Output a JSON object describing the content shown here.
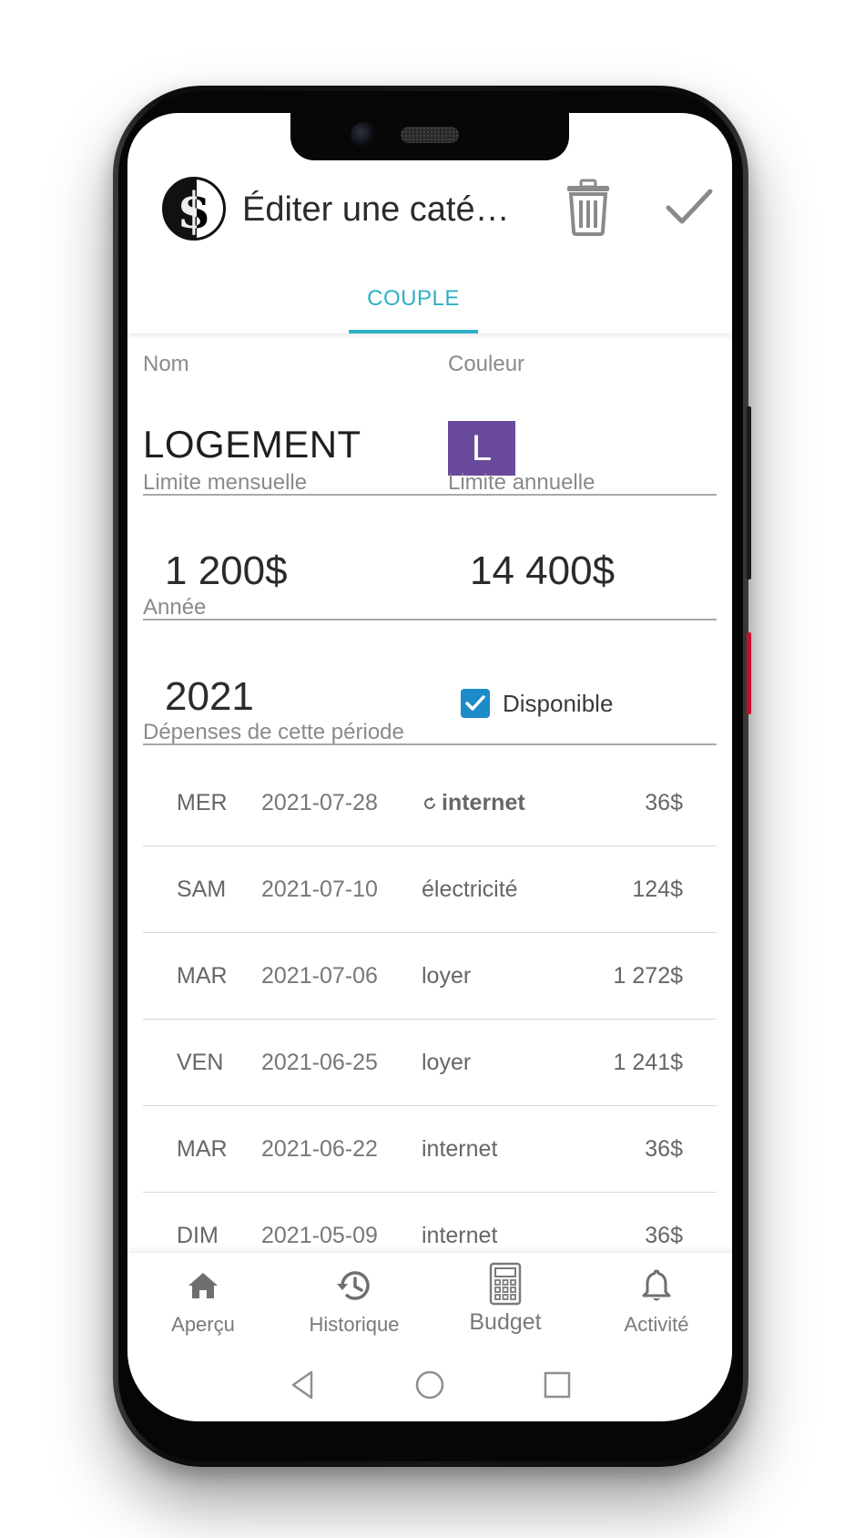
{
  "app": {
    "logo_glyph": "$",
    "title": "Éditer une catégo...",
    "delete_icon": "trash-icon",
    "confirm_icon": "check-icon"
  },
  "tabs": [
    {
      "label": "COUPLE",
      "active": true
    }
  ],
  "form": {
    "name": {
      "label": "Nom",
      "value": "LOGEMENT"
    },
    "color": {
      "label": "Couleur",
      "letter": "L",
      "hex": "#6a4a9b"
    },
    "monthly_limit": {
      "label": "Limite mensuelle",
      "value": "1 200$"
    },
    "annual_limit": {
      "label": "Limite annuelle",
      "value": "14 400$"
    },
    "year": {
      "label": "Année",
      "value": "2021"
    },
    "available": {
      "label": "Disponible",
      "checked": true
    }
  },
  "expenses": {
    "label": "Dépenses de cette période",
    "items": [
      {
        "day": "MER",
        "date": "2021-07-28",
        "description": "internet",
        "amount": "36$",
        "recurring": true
      },
      {
        "day": "SAM",
        "date": "2021-07-10",
        "description": "électricité",
        "amount": "124$",
        "recurring": false
      },
      {
        "day": "MAR",
        "date": "2021-07-06",
        "description": "loyer",
        "amount": "1 272$",
        "recurring": false
      },
      {
        "day": "VEN",
        "date": "2021-06-25",
        "description": "loyer",
        "amount": "1 241$",
        "recurring": false
      },
      {
        "day": "MAR",
        "date": "2021-06-22",
        "description": "internet",
        "amount": "36$",
        "recurring": false
      },
      {
        "day": "DIM",
        "date": "2021-05-09",
        "description": "internet",
        "amount": "36$",
        "recurring": false
      }
    ]
  },
  "bottom_nav": [
    {
      "label": "Aperçu",
      "icon": "home-icon"
    },
    {
      "label": "Historique",
      "icon": "history-icon"
    },
    {
      "label": "Budget",
      "icon": "calculator-icon",
      "active": true
    },
    {
      "label": "Activité",
      "icon": "bell-icon"
    }
  ],
  "colors": {
    "accent": "#2fb1c6",
    "checkbox": "#1d8ac9",
    "category": "#6a4a9b"
  }
}
